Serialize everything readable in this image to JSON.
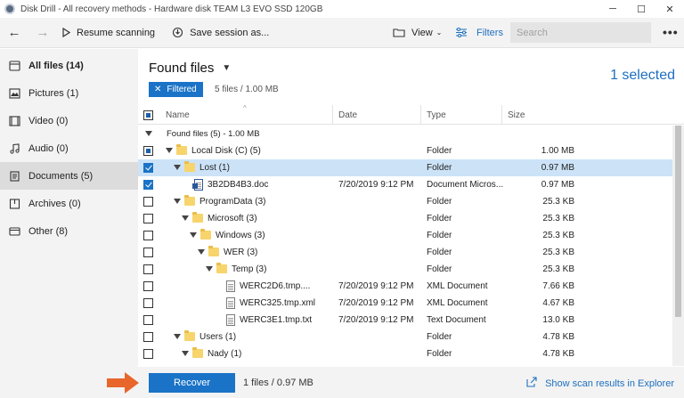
{
  "window": {
    "title": "Disk Drill - All recovery methods - Hardware disk TEAM L3 EVO SSD 120GB",
    "minimize": "─",
    "maximize": "☐",
    "close": "✕"
  },
  "toolbar": {
    "back": "←",
    "forward": "→",
    "resume_label": "Resume scanning",
    "save_label": "Save session as...",
    "view_label": "View",
    "filters_label": "Filters",
    "search_placeholder": "Search",
    "more": "•••"
  },
  "sidebar": {
    "items": [
      {
        "label": "All files (14)",
        "icon": "all-files-icon"
      },
      {
        "label": "Pictures (1)",
        "icon": "pictures-icon"
      },
      {
        "label": "Video (0)",
        "icon": "video-icon"
      },
      {
        "label": "Audio (0)",
        "icon": "audio-icon"
      },
      {
        "label": "Documents (5)",
        "icon": "documents-icon",
        "active": true
      },
      {
        "label": "Archives (0)",
        "icon": "archives-icon"
      },
      {
        "label": "Other (8)",
        "icon": "other-icon"
      }
    ]
  },
  "main": {
    "title": "Found files",
    "selected": "1 selected",
    "filter_chip": "Filtered",
    "filter_summary": "5 files / 1.00 MB",
    "columns": {
      "name": "Name",
      "date": "Date",
      "type": "Type",
      "size": "Size"
    },
    "group_header": "Found files (5) - 1.00 MB",
    "rows": [
      {
        "name": "Local Disk (C) (5)",
        "date": "",
        "type": "Folder",
        "size": "1.00 MB",
        "level": 0,
        "kind": "folder",
        "check": "partial",
        "expanded": true
      },
      {
        "name": "Lost (1)",
        "date": "",
        "type": "Folder",
        "size": "0.97 MB",
        "level": 1,
        "kind": "folder",
        "check": "checked",
        "expanded": true,
        "highlight": true
      },
      {
        "name": "3B2DB4B3.doc",
        "date": "7/20/2019 9:12 PM",
        "type": "Document Micros...",
        "size": "0.97 MB",
        "level": 2,
        "kind": "word",
        "check": "checked"
      },
      {
        "name": "ProgramData (3)",
        "date": "",
        "type": "Folder",
        "size": "25.3 KB",
        "level": 1,
        "kind": "folder",
        "check": "none",
        "expanded": true
      },
      {
        "name": "Microsoft (3)",
        "date": "",
        "type": "Folder",
        "size": "25.3 KB",
        "level": 2,
        "kind": "folder",
        "check": "none",
        "expanded": true
      },
      {
        "name": "Windows (3)",
        "date": "",
        "type": "Folder",
        "size": "25.3 KB",
        "level": 3,
        "kind": "folder",
        "check": "none",
        "expanded": true
      },
      {
        "name": "WER (3)",
        "date": "",
        "type": "Folder",
        "size": "25.3 KB",
        "level": 4,
        "kind": "folder",
        "check": "none",
        "expanded": true
      },
      {
        "name": "Temp (3)",
        "date": "",
        "type": "Folder",
        "size": "25.3 KB",
        "level": 5,
        "kind": "folder",
        "check": "none",
        "expanded": true
      },
      {
        "name": "WERC2D6.tmp....",
        "date": "7/20/2019 9:12 PM",
        "type": "XML Document",
        "size": "7.66 KB",
        "level": 6,
        "kind": "doc",
        "check": "none"
      },
      {
        "name": "WERC325.tmp.xml",
        "date": "7/20/2019 9:12 PM",
        "type": "XML Document",
        "size": "4.67 KB",
        "level": 6,
        "kind": "doc",
        "check": "none"
      },
      {
        "name": "WERC3E1.tmp.txt",
        "date": "7/20/2019 9:12 PM",
        "type": "Text Document",
        "size": "13.0 KB",
        "level": 6,
        "kind": "doc",
        "check": "none"
      },
      {
        "name": "Users (1)",
        "date": "",
        "type": "Folder",
        "size": "4.78 KB",
        "level": 1,
        "kind": "folder",
        "check": "none",
        "expanded": true
      },
      {
        "name": "Nady (1)",
        "date": "",
        "type": "Folder",
        "size": "4.78 KB",
        "level": 2,
        "kind": "folder",
        "check": "none",
        "expanded": true
      }
    ]
  },
  "bottom": {
    "recover_label": "Recover",
    "summary": "1 files / 0.97 MB",
    "explorer_label": "Show scan results in Explorer"
  },
  "colors": {
    "accent": "#1a73c7",
    "link": "#1e6fbf",
    "highlight_row": "#cce3f7",
    "pointer_arrow": "#e8652b"
  }
}
